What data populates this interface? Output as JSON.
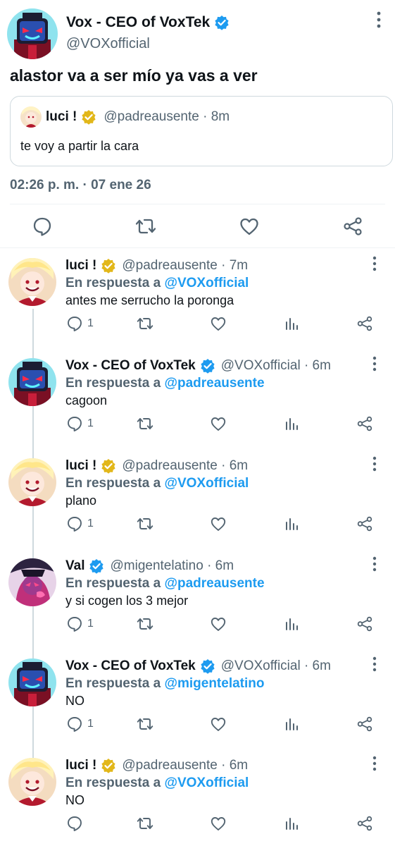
{
  "main_tweet": {
    "author_name": "Vox - CEO of VoxTek",
    "author_handle": "@VOXofficial",
    "verified_badge": "blue-verified-icon",
    "text": "alastor va a ser mío ya vas a ver",
    "quote": {
      "author_name": "luci !",
      "verified_badge": "gold-verified-icon",
      "meta": "@padreausente · 8m",
      "text": "te voy a partir la cara"
    },
    "timestamp": "02:26 p. m. · 07 ene 26",
    "actions": [
      "reply-icon",
      "retweet-icon",
      "like-icon",
      "share-icon"
    ]
  },
  "reply_label_prefix": "En respuesta a",
  "replies": [
    {
      "author_name": "luci !",
      "verified_badge": "gold-verified-icon",
      "meta": "@padreausente · 7m",
      "reply_to": "@VOXofficial",
      "text": "antes me serrucho la poronga",
      "reply_count": "1"
    },
    {
      "author_name": "Vox - CEO of VoxTek",
      "verified_badge": "blue-verified-icon",
      "meta": "@VOXofficial · 6m",
      "reply_to": "@padreausente",
      "text": "cagoon",
      "reply_count": "1"
    },
    {
      "author_name": "luci !",
      "verified_badge": "gold-verified-icon",
      "meta": "@padreausente · 6m",
      "reply_to": "@VOXofficial",
      "text": "plano",
      "reply_count": "1"
    },
    {
      "author_name": "Val",
      "verified_badge": "blue-verified-icon",
      "meta": "@migentelatino · 6m",
      "reply_to": "@padreausente",
      "text": "y si cogen los 3 mejor",
      "reply_count": "1"
    },
    {
      "author_name": "Vox - CEO of VoxTek",
      "verified_badge": "blue-verified-icon",
      "meta": "@VOXofficial · 6m",
      "reply_to": "@migentelatino",
      "text": "NO",
      "reply_count": "1"
    },
    {
      "author_name": "luci !",
      "verified_badge": "gold-verified-icon",
      "meta": "@padreausente · 6m",
      "reply_to": "@VOXofficial",
      "text": "NO",
      "reply_count": ""
    }
  ],
  "colors": {
    "link_blue": "#1d9bf0",
    "blue_verified": "#1d9bf0",
    "gold_verified": "#e2b719",
    "secondary_text": "#536471",
    "icon_gray": "#536471",
    "divider": "#eff3f4"
  }
}
